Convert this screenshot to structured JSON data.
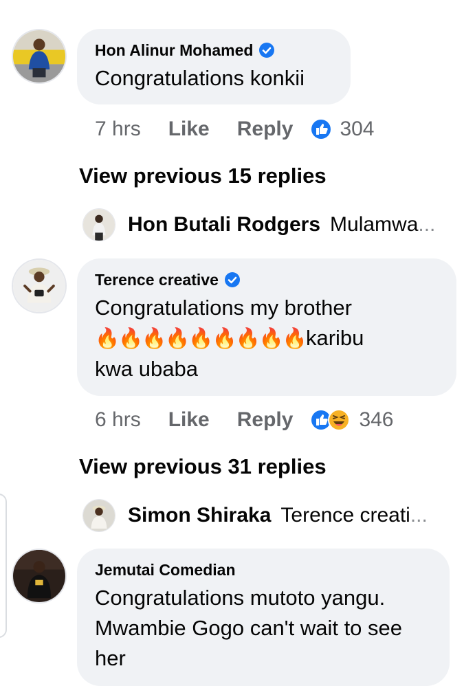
{
  "comments": [
    {
      "author": "Hon Alinur Mohamed",
      "verified": true,
      "text": "Congratulations konkii",
      "time": "7 hrs",
      "like_label": "Like",
      "reply_label": "Reply",
      "reactions": [
        "like"
      ],
      "reaction_count": "304"
    },
    {
      "author": "Terence creative",
      "verified": true,
      "text_line1": "Congratulations my brother",
      "fire_emojis": "🔥🔥🔥🔥🔥🔥🔥🔥🔥",
      "text_line2_suffix": "karibu",
      "text_line3": "kwa ubaba",
      "time": "6 hrs",
      "like_label": "Like",
      "reply_label": "Reply",
      "reactions": [
        "like",
        "haha"
      ],
      "reaction_count": "346"
    },
    {
      "author": "Jemutai Comedian",
      "verified": false,
      "text_line1": "Congratulations mutoto yangu.",
      "text_line2": "Mwambie Gogo can't wait to see",
      "text_line3": "her"
    }
  ],
  "view_previous": [
    "View previous 15 replies",
    "View previous 31 replies"
  ],
  "reply_previews": [
    {
      "author": "Hon Butali Rodgers",
      "text": "Mulamwa",
      "ellipsis": "..."
    },
    {
      "author": "Simon Shiraka",
      "text": "Terence creati",
      "ellipsis": "..."
    }
  ],
  "colors": {
    "bubble_bg": "#f0f2f5",
    "meta_text": "#65676b",
    "verified_blue": "#1877f2",
    "like_blue": "#1877f2",
    "haha_yellow": "#f7b125"
  },
  "icons": {
    "verified": "verified-badge-icon",
    "like": "like-reaction-icon",
    "haha": "haha-reaction-icon"
  }
}
